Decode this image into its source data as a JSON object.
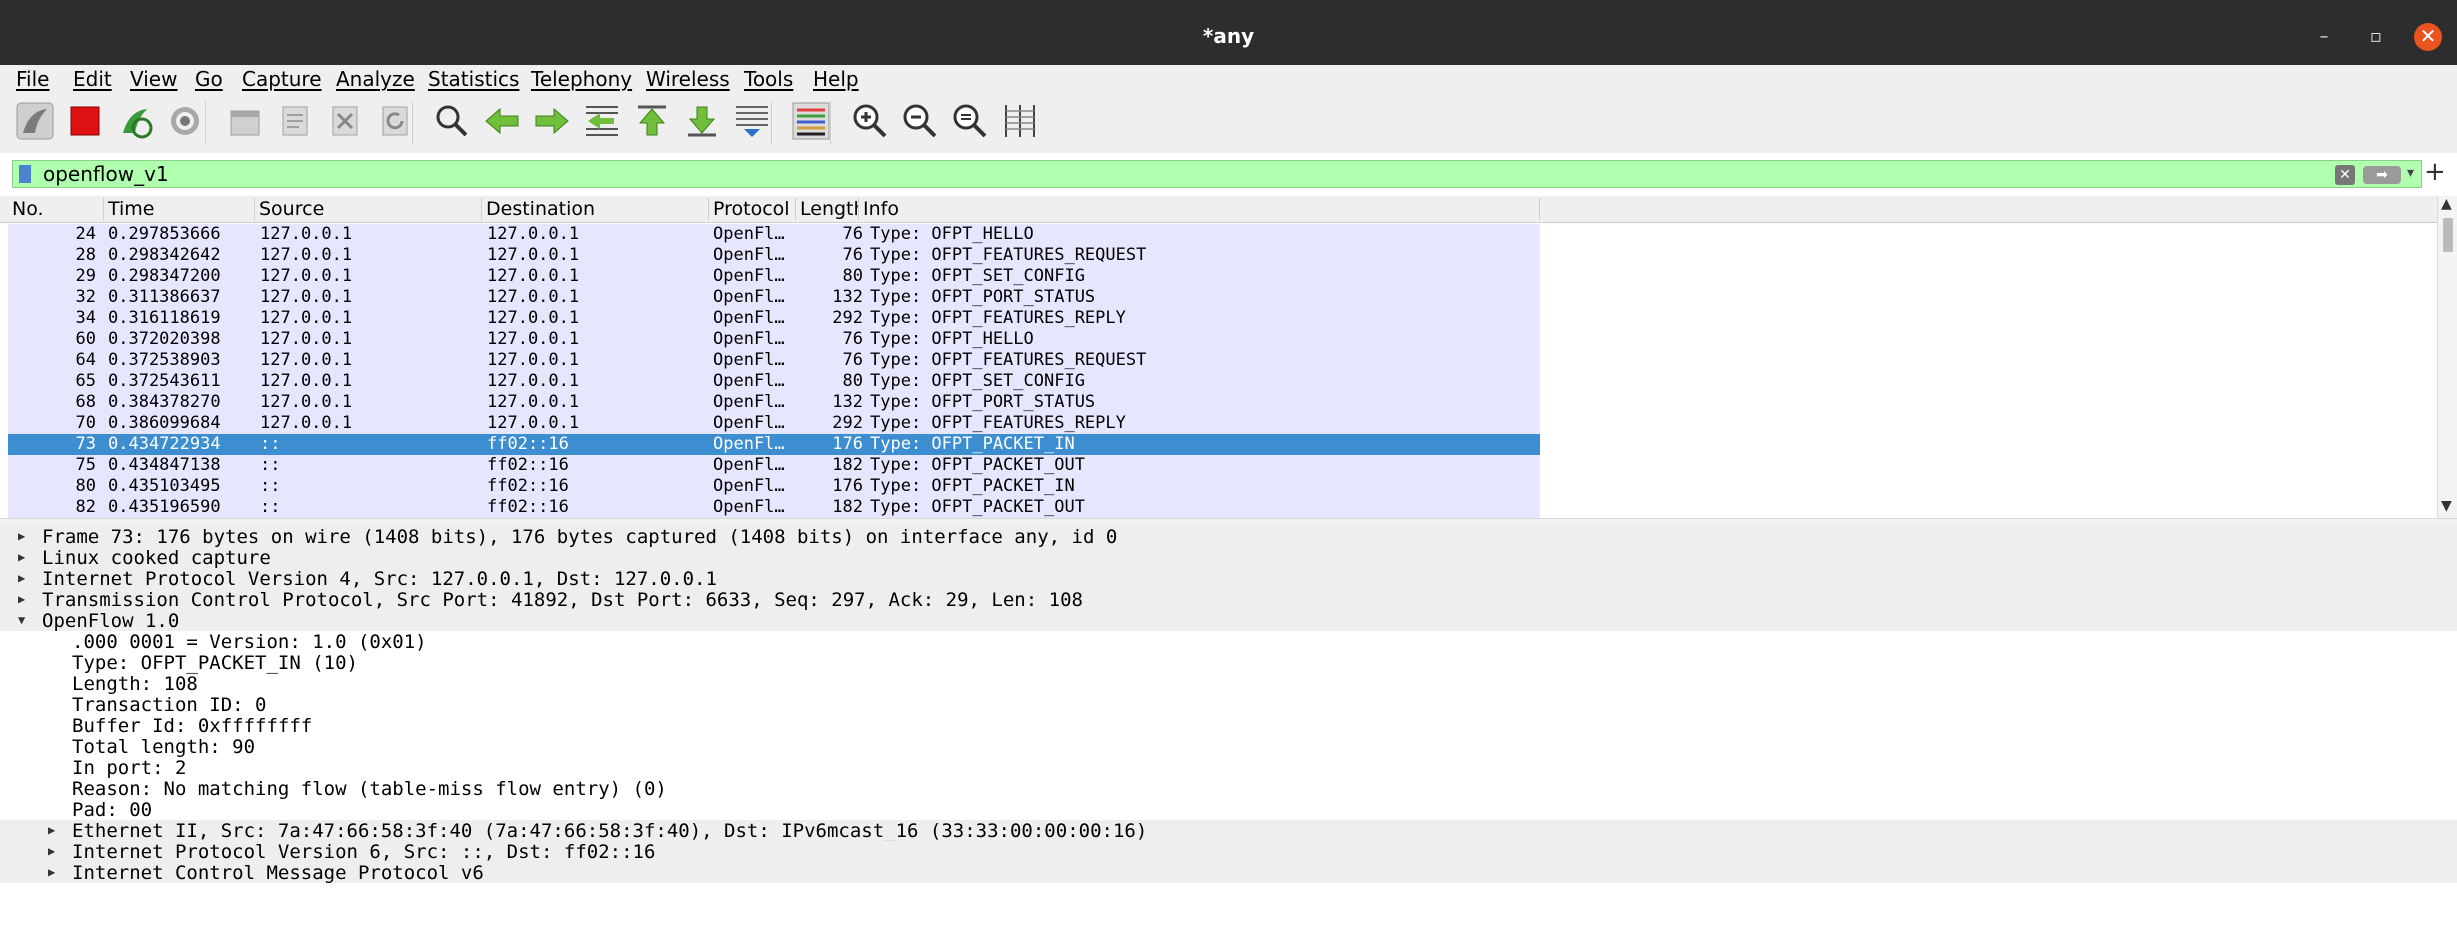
{
  "window": {
    "title": "*any"
  },
  "menu": [
    "File",
    "Edit",
    "View",
    "Go",
    "Capture",
    "Analyze",
    "Statistics",
    "Telephony",
    "Wireless",
    "Tools",
    "Help"
  ],
  "filter": {
    "value": "openflow_v1"
  },
  "columns": [
    "No.",
    "Time",
    "Source",
    "Destination",
    "Protocol",
    "Length",
    "Info"
  ],
  "packets": [
    {
      "no": "24",
      "time": "0.297853666",
      "src": "127.0.0.1",
      "dst": "127.0.0.1",
      "proto": "OpenFl…",
      "len": "76",
      "info": "Type: OFPT_HELLO"
    },
    {
      "no": "28",
      "time": "0.298342642",
      "src": "127.0.0.1",
      "dst": "127.0.0.1",
      "proto": "OpenFl…",
      "len": "76",
      "info": "Type: OFPT_FEATURES_REQUEST"
    },
    {
      "no": "29",
      "time": "0.298347200",
      "src": "127.0.0.1",
      "dst": "127.0.0.1",
      "proto": "OpenFl…",
      "len": "80",
      "info": "Type: OFPT_SET_CONFIG"
    },
    {
      "no": "32",
      "time": "0.311386637",
      "src": "127.0.0.1",
      "dst": "127.0.0.1",
      "proto": "OpenFl…",
      "len": "132",
      "info": "Type: OFPT_PORT_STATUS"
    },
    {
      "no": "34",
      "time": "0.316118619",
      "src": "127.0.0.1",
      "dst": "127.0.0.1",
      "proto": "OpenFl…",
      "len": "292",
      "info": "Type: OFPT_FEATURES_REPLY"
    },
    {
      "no": "60",
      "time": "0.372020398",
      "src": "127.0.0.1",
      "dst": "127.0.0.1",
      "proto": "OpenFl…",
      "len": "76",
      "info": "Type: OFPT_HELLO"
    },
    {
      "no": "64",
      "time": "0.372538903",
      "src": "127.0.0.1",
      "dst": "127.0.0.1",
      "proto": "OpenFl…",
      "len": "76",
      "info": "Type: OFPT_FEATURES_REQUEST"
    },
    {
      "no": "65",
      "time": "0.372543611",
      "src": "127.0.0.1",
      "dst": "127.0.0.1",
      "proto": "OpenFl…",
      "len": "80",
      "info": "Type: OFPT_SET_CONFIG"
    },
    {
      "no": "68",
      "time": "0.384378270",
      "src": "127.0.0.1",
      "dst": "127.0.0.1",
      "proto": "OpenFl…",
      "len": "132",
      "info": "Type: OFPT_PORT_STATUS"
    },
    {
      "no": "70",
      "time": "0.386099684",
      "src": "127.0.0.1",
      "dst": "127.0.0.1",
      "proto": "OpenFl…",
      "len": "292",
      "info": "Type: OFPT_FEATURES_REPLY"
    },
    {
      "no": "73",
      "time": "0.434722934",
      "src": "::",
      "dst": "ff02::16",
      "proto": "OpenFl…",
      "len": "176",
      "info": "Type: OFPT_PACKET_IN",
      "selected": true
    },
    {
      "no": "75",
      "time": "0.434847138",
      "src": "::",
      "dst": "ff02::16",
      "proto": "OpenFl…",
      "len": "182",
      "info": "Type: OFPT_PACKET_OUT"
    },
    {
      "no": "80",
      "time": "0.435103495",
      "src": "::",
      "dst": "ff02::16",
      "proto": "OpenFl…",
      "len": "176",
      "info": "Type: OFPT_PACKET_IN"
    },
    {
      "no": "82",
      "time": "0.435196590",
      "src": "::",
      "dst": "ff02::16",
      "proto": "OpenFl…",
      "len": "182",
      "info": "Type: OFPT_PACKET_OUT"
    }
  ],
  "details": [
    {
      "text": "Frame 73: 176 bytes on wire (1408 bits), 176 bytes captured (1408 bits) on interface any, id 0",
      "level": 0,
      "expander": "collapsed"
    },
    {
      "text": "Linux cooked capture",
      "level": 0,
      "expander": "collapsed"
    },
    {
      "text": "Internet Protocol Version 4, Src: 127.0.0.1, Dst: 127.0.0.1",
      "level": 0,
      "expander": "collapsed"
    },
    {
      "text": "Transmission Control Protocol, Src Port: 41892, Dst Port: 6633, Seq: 297, Ack: 29, Len: 108",
      "level": 0,
      "expander": "collapsed"
    },
    {
      "text": "OpenFlow 1.0",
      "level": 0,
      "expander": "expanded"
    },
    {
      "text": ".000 0001 = Version: 1.0 (0x01)",
      "level": 1,
      "expander": "none"
    },
    {
      "text": "Type: OFPT_PACKET_IN (10)",
      "level": 1,
      "expander": "none"
    },
    {
      "text": "Length: 108",
      "level": 1,
      "expander": "none"
    },
    {
      "text": "Transaction ID: 0",
      "level": 1,
      "expander": "none"
    },
    {
      "text": "Buffer Id: 0xffffffff",
      "level": 1,
      "expander": "none"
    },
    {
      "text": "Total length: 90",
      "level": 1,
      "expander": "none"
    },
    {
      "text": "In port: 2",
      "level": 1,
      "expander": "none"
    },
    {
      "text": "Reason: No matching flow (table-miss flow entry) (0)",
      "level": 1,
      "expander": "none"
    },
    {
      "text": "Pad: 00",
      "level": 1,
      "expander": "none"
    },
    {
      "text": "Ethernet II, Src: 7a:47:66:58:3f:40 (7a:47:66:58:3f:40), Dst: IPv6mcast_16 (33:33:00:00:00:16)",
      "level": 1,
      "expander": "collapsed"
    },
    {
      "text": "Internet Protocol Version 6, Src: ::, Dst: ff02::16",
      "level": 1,
      "expander": "collapsed"
    },
    {
      "text": "Internet Control Message Protocol v6",
      "level": 1,
      "expander": "collapsed"
    }
  ],
  "toolbar": [
    {
      "name": "start-capture-icon",
      "kind": "fin"
    },
    {
      "name": "stop-capture-icon",
      "kind": "stop"
    },
    {
      "name": "restart-capture-icon",
      "kind": "restart"
    },
    {
      "name": "capture-options-icon",
      "kind": "gear"
    },
    {
      "name": "open-file-icon",
      "kind": "file"
    },
    {
      "name": "save-file-icon",
      "kind": "file2"
    },
    {
      "name": "close-file-icon",
      "kind": "closefile"
    },
    {
      "name": "reload-file-icon",
      "kind": "reload"
    },
    {
      "name": "find-packet-icon",
      "kind": "search"
    },
    {
      "name": "go-back-icon",
      "kind": "left"
    },
    {
      "name": "go-forward-icon",
      "kind": "right"
    },
    {
      "name": "go-to-packet-icon",
      "kind": "goto"
    },
    {
      "name": "go-first-packet-icon",
      "kind": "first"
    },
    {
      "name": "go-last-packet-icon",
      "kind": "last"
    },
    {
      "name": "autoscroll-icon",
      "kind": "autoscroll"
    },
    {
      "name": "colorize-icon",
      "kind": "colorize"
    },
    {
      "name": "zoom-in-icon",
      "kind": "zoomin"
    },
    {
      "name": "zoom-out-icon",
      "kind": "zoomout"
    },
    {
      "name": "zoom-normal-icon",
      "kind": "zoomnormal"
    },
    {
      "name": "resize-columns-icon",
      "kind": "resize"
    }
  ],
  "colors": {
    "row_bg": "#e7e6ff",
    "selected_row": "#3c8ed0",
    "filter_bg": "#afffaf",
    "close_button": "#e95420"
  }
}
